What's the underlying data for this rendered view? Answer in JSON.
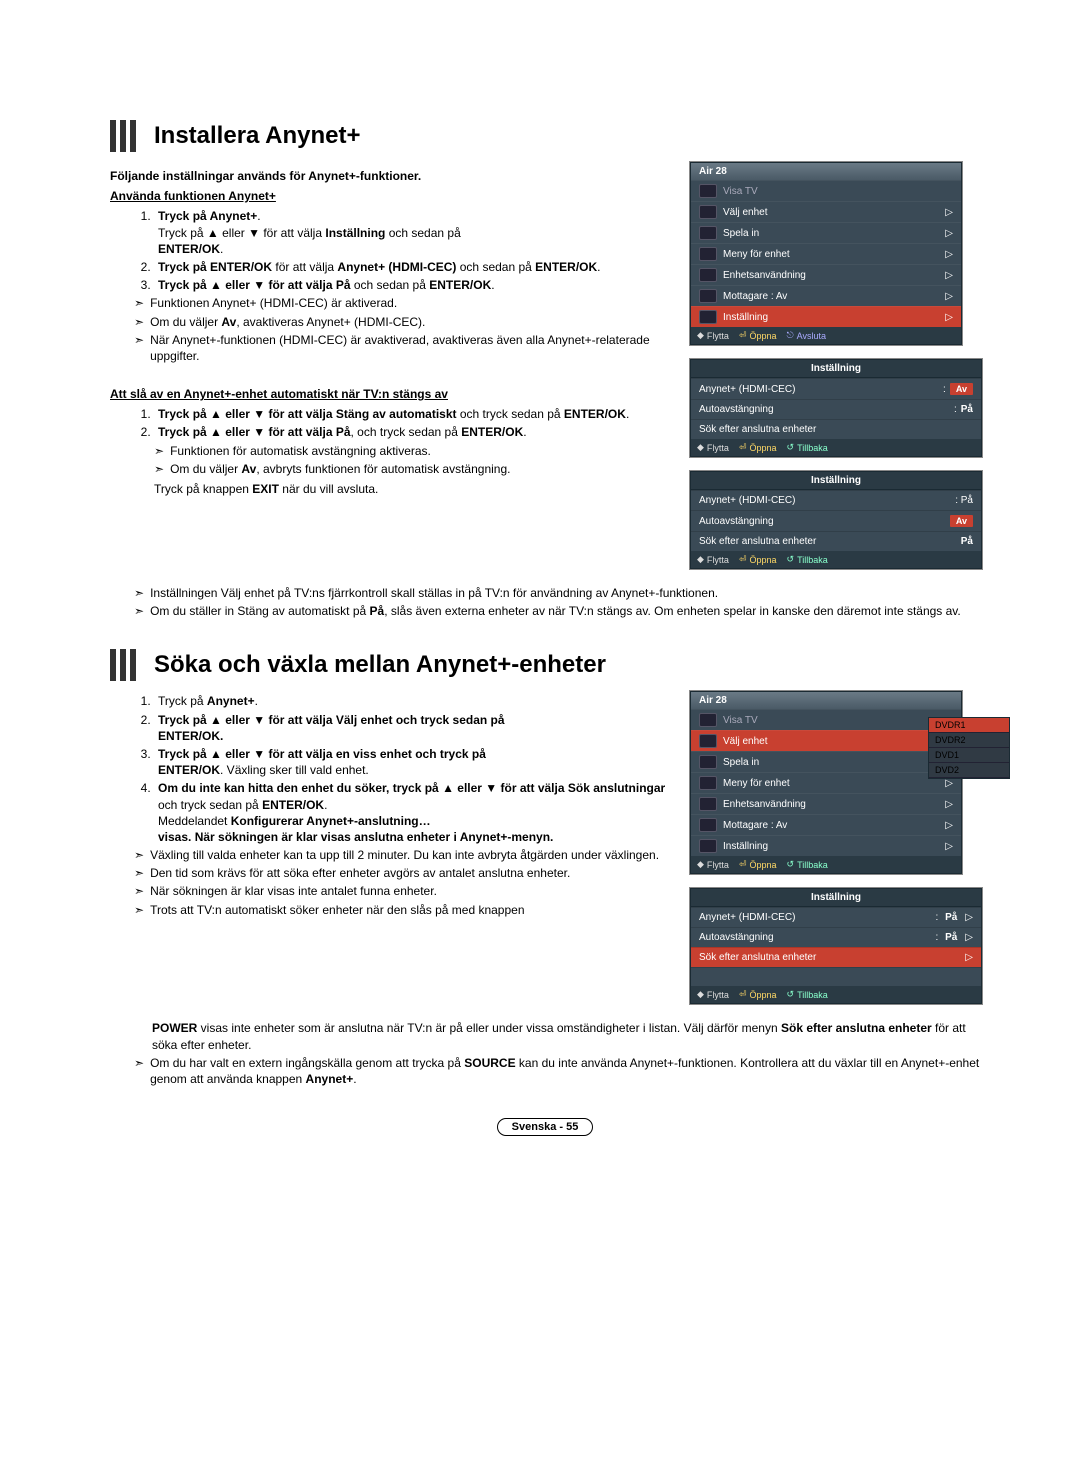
{
  "section1": {
    "title": "Installera Anynet+",
    "intro_bold": "Följande inställningar används för Anynet+-funktioner.",
    "sub_underline": "Använda funktionen Anynet+",
    "step1_a": "Tryck på ",
    "step1_b": "Anynet+",
    "step1_c": ".",
    "step1_d": "Tryck på ▲ eller ▼ för att välja ",
    "step1_e": "Inställning",
    "step1_f": " och sedan på ",
    "step1_g": "ENTER/OK",
    "step1_h": ".",
    "step2_a": "Tryck på ",
    "step2_b": "ENTER/OK",
    "step2_c": " för att välja ",
    "step2_d": "Anynet+ (HDMI-CEC)",
    "step2_e": " och sedan på ",
    "step2_f": "ENTER/OK",
    "step2_g": ".",
    "step3_a": "Tryck på ▲ eller ▼ för att välja ",
    "step3_b": "På",
    "step3_c": " och sedan på ",
    "step3_d": "ENTER/OK",
    "step3_e": ".",
    "note1": "Funktionen Anynet+ (HDMI-CEC) är aktiverad.",
    "note2_a": "Om du väljer ",
    "note2_b": "Av",
    "note2_c": ", avaktiveras Anynet+ (HDMI-CEC).",
    "note3": "När Anynet+-funktionen (HDMI-CEC) är avaktiverad, avaktiveras även alla Anynet+-relaterade uppgifter.",
    "sub2_underline": "Att slå av en Anynet+-enhet automatiskt när TV:n stängs av",
    "b_step1_a": "Tryck på ▲ eller ▼ för att välja ",
    "b_step1_b": "Stäng av automatiskt",
    "b_step1_c": " och tryck sedan på ",
    "b_step1_d": "ENTER/OK",
    "b_step1_e": ".",
    "b_step2_a": "Tryck på ▲ eller ▼ för att välja ",
    "b_step2_b": "På",
    "b_step2_c": ", och tryck sedan på ",
    "b_step2_d": "ENTER/OK",
    "b_step2_e": ".",
    "b_note1": "Funktionen för automatisk avstängning aktiveras.",
    "b_note2_a": "Om du väljer ",
    "b_note2_b": "Av",
    "b_note2_c": ", avbryts funktionen för automatisk avstängning.",
    "b_plain_a": "Tryck på knappen ",
    "b_plain_b": "EXIT",
    "b_plain_c": " när du vill avsluta.",
    "b_wide1": "Inställningen Välj enhet på TV:ns fjärrkontroll skall ställas in på TV:n för användning av Anynet+-funktionen.",
    "b_wide2_a": "Om du ställer in Stäng av automatiskt på ",
    "b_wide2_b": "På",
    "b_wide2_c": ", slås även externa enheter av när TV:n stängs av. Om enheten spelar in kanske den däremot inte stängs av."
  },
  "section2": {
    "title": "Söka och växla mellan Anynet+-enheter",
    "s1_a": "Tryck på ",
    "s1_b": "Anynet+",
    "s1_c": ".",
    "s2_a": "Tryck på ▲ eller ▼ för att välja Välj enhet och tryck sedan på ",
    "s2_b": "ENTER/OK.",
    "s3_a": "Tryck på ▲ eller ▼ för att välja en viss enhet och tryck på ",
    "s3_b": "ENTER/OK",
    "s3_c": ". Växling sker till vald enhet.",
    "s4_a": "Om du inte kan hitta den enhet du söker, tryck på ▲ eller ▼ för att välja ",
    "s4_b": "Sök anslutningar",
    "s4_c": " och tryck sedan på ",
    "s4_d": "ENTER/OK",
    "s4_e": ".",
    "s4_msg_a": "Meddelandet ",
    "s4_msg_b": "Konfigurerar Anynet+-anslutning…",
    "s4_msg_c": " ",
    "s4_msg_d": "visas. När sökningen är klar visas anslutna enheter i Anynet+-menyn.",
    "n1": "Växling till valda enheter kan ta upp till 2 minuter. Du kan inte avbryta åtgärden under växlingen.",
    "n2": "Den tid som krävs för att söka efter enheter avgörs av antalet anslutna enheter.",
    "n3": "När sökningen är klar visas inte antalet funna enheter.",
    "n4_a": "Trots att TV:n automatiskt söker enheter när den slås på med knappen ",
    "n4_b": "POWER",
    "n4_c": " visas inte enheter som är anslutna när TV:n är på eller under vissa omständigheter i listan. Välj därför menyn ",
    "n4_d": "Sök efter anslutna enheter",
    "n4_e": " för att söka efter enheter.",
    "n5_a": "Om du har valt en extern ingångskälla genom att trycka på ",
    "n5_b": "SOURCE",
    "n5_c": " kan du inte använda Anynet+-funktionen. Kontrollera att du växlar till en Anynet+-enhet genom att använda knappen ",
    "n5_d": "Anynet+",
    "n5_e": "."
  },
  "osd": {
    "air": "Air 28",
    "visa_tv": "Visa TV",
    "valj_enhet": "Välj enhet",
    "spela_in": "Spela in",
    "meny_for_enhet": "Meny för enhet",
    "enhetsanvandning": "Enhetsanvändning",
    "mottagare": "Mottagare",
    "mottagare_val": ": Av",
    "installning": "Inställning",
    "setting_title": "Inställning",
    "hdmi_cec": "Anynet+ (HDMI-CEC)",
    "auto_off": "Autoavstängning",
    "sok": "Sök efter anslutna enheter",
    "av": "Av",
    "pa": "På",
    "colon_pa": ": På",
    "flytta": "Flytta",
    "oppna": "Öppna",
    "tillbaka": "Tillbaka",
    "avsluta": "Avsluta",
    "dvdr1": "DVDR1",
    "dvdr2": "DVDR2",
    "dvd1": "DVD1",
    "dvd2": "DVD2"
  },
  "footer": "Svenska - 55"
}
